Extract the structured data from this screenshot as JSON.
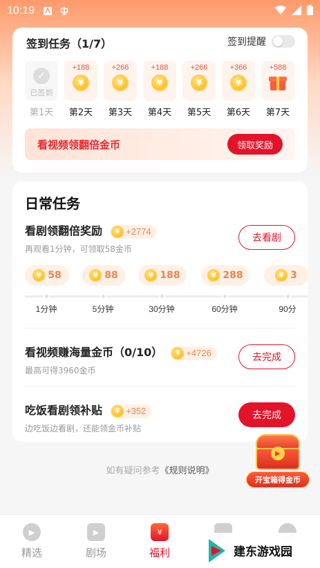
{
  "status_bar": {
    "time": "10:19"
  },
  "signin": {
    "title": "签到任务（1/7）",
    "remind_label": "签到提醒",
    "days": [
      {
        "reward": "",
        "state": "已签到",
        "name": "第1天",
        "type": "done"
      },
      {
        "reward": "+188",
        "name": "第2天",
        "type": "coin"
      },
      {
        "reward": "+266",
        "name": "第3天",
        "type": "coin"
      },
      {
        "reward": "+188",
        "name": "第4天",
        "type": "coin"
      },
      {
        "reward": "+266",
        "name": "第5天",
        "type": "coin"
      },
      {
        "reward": "+366",
        "name": "第6天",
        "type": "coin"
      },
      {
        "reward": "+588",
        "name": "第7天",
        "type": "gift"
      }
    ],
    "double_text": "看视频领翻倍金币",
    "claim_button": "领取奖励"
  },
  "daily": {
    "title": "日常任务",
    "tasks": [
      {
        "name": "看剧领翻倍奖励",
        "bonus": "+2774",
        "sub": "再观看1分钟，可领取58金币",
        "button": "去看剧"
      },
      {
        "name": "看视频赚海量金币（0/10）",
        "bonus": "+4726",
        "sub": "最高可得3960金币",
        "button": "去完成"
      },
      {
        "name": "吃饭看剧领补贴",
        "bonus": "+352",
        "sub": "边吃饭边看剧，还能领金币补贴",
        "button": "去完成"
      }
    ],
    "milestones": [
      {
        "coins": "58",
        "time": "1分钟"
      },
      {
        "coins": "88",
        "time": "5分钟"
      },
      {
        "coins": "188",
        "time": "30分钟"
      },
      {
        "coins": "288",
        "time": "60分钟"
      },
      {
        "coins": "3",
        "time": "90分"
      }
    ]
  },
  "rules": {
    "prefix": "如有疑问参考",
    "link": "《规则说明》"
  },
  "treasure": {
    "label": "开宝箱得金币"
  },
  "nav": {
    "items": [
      {
        "label": "精选"
      },
      {
        "label": "剧场"
      },
      {
        "label": "福利"
      }
    ]
  },
  "watermark": {
    "text": "建东游戏园"
  },
  "colors": {
    "accent": "#e3132a",
    "coin": "#ffbe22",
    "badge_text": "#e98650"
  }
}
